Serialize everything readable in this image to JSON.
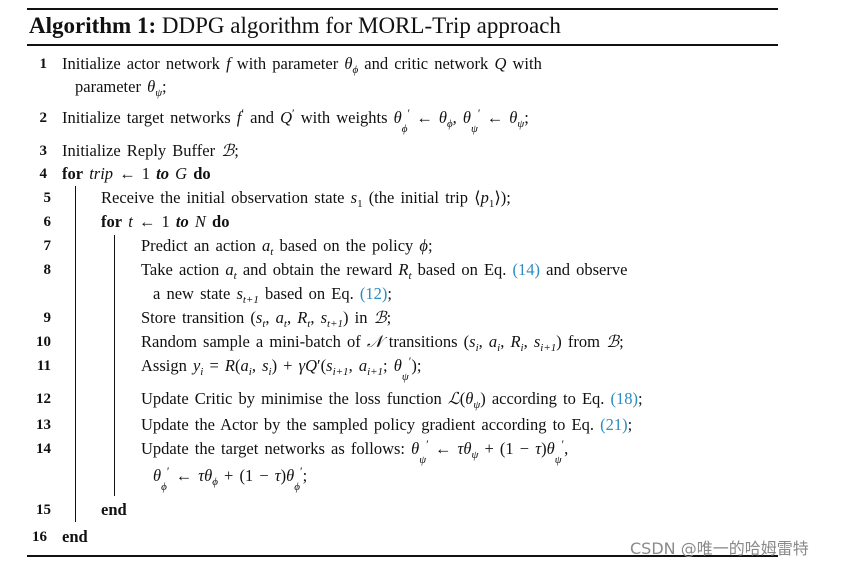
{
  "algorithm": {
    "label": "Algorithm 1:",
    "title": "DDPG algorithm for MORL-Trip approach"
  },
  "lines": [
    {
      "num": "1",
      "text": "Initialize actor network f with parameter θ_ϕ and critic network Q with parameter θ_ψ;"
    },
    {
      "num": "2",
      "text": "Initialize target networks f′ and Q′ with weights θ_ϕ′ ← θ_ϕ, θ_ψ′ ← θ_ψ;"
    },
    {
      "num": "3",
      "text": "Initialize Reply Buffer B;"
    },
    {
      "num": "4",
      "text": "for trip ← 1 to G do"
    },
    {
      "num": "5",
      "text": "Receive the initial observation state s_1 (the initial trip ⟨p_1⟩);"
    },
    {
      "num": "6",
      "text": "for t ← 1 to N do"
    },
    {
      "num": "7",
      "text": "Predict an action a_t based on the policy ϕ;"
    },
    {
      "num": "8",
      "text": "Take action a_t and obtain the reward R_t based on Eq. (14) and observe a new state s_{t+1} based on Eq. (12);"
    },
    {
      "num": "9",
      "text": "Store transition (s_t, a_t, R_t, s_{t+1}) in B;"
    },
    {
      "num": "10",
      "text": "Random sample a mini-batch of N transitions (s_i, a_i, R_i, s_{i+1}) from B;"
    },
    {
      "num": "11",
      "text": "Assign y_i = R(a_i, s_i) + γQ′(s_{i+1}, a_{i+1}; θ_ψ′);"
    },
    {
      "num": "12",
      "text": "Update Critic by minimise the loss function L(θ_ψ) according to Eq. (18);"
    },
    {
      "num": "13",
      "text": "Update the Actor by the sampled policy gradient according to Eq. (21);"
    },
    {
      "num": "14",
      "text": "Update the target networks as follows: θ_ψ′ ← τθ_ψ + (1 − τ)θ_ψ′, θ_ϕ′ ← τθ_ϕ + (1 − τ)θ_ϕ′;"
    },
    {
      "num": "15",
      "text": "end"
    },
    {
      "num": "16",
      "text": "end"
    }
  ],
  "words": {
    "initialize": "Initialize",
    "actor_network": "actor network",
    "with_parameter": "with parameter",
    "and_critic_network": "and critic network",
    "with": "with",
    "parameter": "parameter",
    "target_networks": "target networks",
    "and": "and",
    "with_weights": "with weights",
    "reply_buffer": "Reply Buffer",
    "for": "for",
    "trip": "trip",
    "to": "to",
    "do": "do",
    "receive": "Receive the initial observation state",
    "initial_trip": "(the initial trip",
    "predict": "Predict an action",
    "based_on_policy": "based on the policy",
    "take_action": "Take action",
    "obtain_reward": "and obtain the reward",
    "based_on_eq": "based on Eq.",
    "and_observe": "and observe",
    "new_state": "a new state",
    "store_transition": "Store transition",
    "in": "in",
    "random_sample": "Random sample a mini-batch of",
    "transitions": "transitions",
    "from": "from",
    "assign": "Assign",
    "update_critic": "Update Critic by minimise the loss function",
    "according_to_eq": "according to Eq.",
    "update_actor": "Update the Actor by the sampled policy gradient according to Eq.",
    "update_target": "Update the target networks as follows:",
    "end": "end"
  },
  "refs": {
    "eq14": "(14)",
    "eq12": "(12)",
    "eq18": "(18)",
    "eq21": "(21)"
  },
  "colors": {
    "link": "#2a8cbf",
    "text": "#111111",
    "watermark": "#8a8a8a"
  },
  "watermark": "CSDN @唯一的哈姆雷特"
}
